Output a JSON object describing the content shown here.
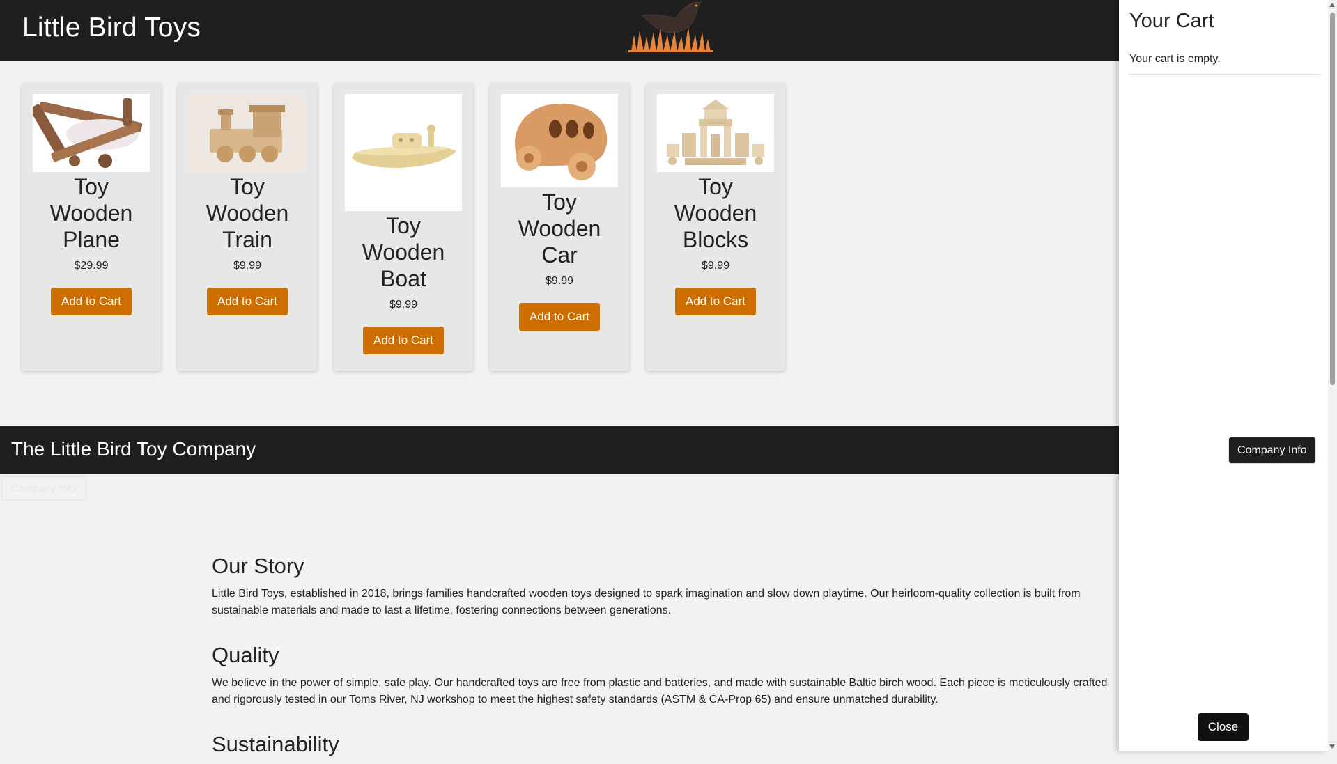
{
  "header": {
    "title": "Little Bird Toys"
  },
  "products": [
    {
      "name": "Toy Wooden Plane",
      "price": "$29.99",
      "button": "Add to Cart"
    },
    {
      "name": "Toy Wooden Train",
      "price": "$9.99",
      "button": "Add to Cart"
    },
    {
      "name": "Toy Wooden Boat",
      "price": "$9.99",
      "button": "Add to Cart"
    },
    {
      "name": "Toy Wooden Car",
      "price": "$9.99",
      "button": "Add to Cart"
    },
    {
      "name": "Toy Wooden Blocks",
      "price": "$9.99",
      "button": "Add to Cart"
    }
  ],
  "footer": {
    "title": "The Little Bird Toy Company",
    "ghost_button": "Company Info"
  },
  "about": {
    "sections": [
      {
        "heading": "Our Story",
        "text": "Little Bird Toys, established in 2018, brings families handcrafted wooden toys designed to spark imagination and slow down playtime. Our heirloom-quality collection is built from sustainable materials and made to last a lifetime, fostering connections between generations."
      },
      {
        "heading": "Quality",
        "text": "We believe in the power of simple, safe play. Our handcrafted toys are free from plastic and batteries, and made with sustainable Baltic birch wood. Each piece is meticulously crafted and rigorously tested in our Toms River, NJ workshop to meet the highest safety standards (ASTM & CA-Prop 65) and ensure unmatched durability."
      },
      {
        "heading": "Sustainability",
        "text": ""
      }
    ]
  },
  "cart": {
    "title": "Your Cart",
    "empty_message": "Your cart is empty.",
    "company_button": "Company Info",
    "close_button": "Close"
  },
  "colors": {
    "header_bg": "#1f1f1f",
    "accent": "#cc6f00",
    "page_bg": "#f2f2f2",
    "card_bg": "#e7e7e7",
    "logo": "#e8843a"
  },
  "icons": [
    "bird-logo-icon",
    "plane-image",
    "train-image",
    "boat-image",
    "car-image",
    "blocks-image"
  ]
}
